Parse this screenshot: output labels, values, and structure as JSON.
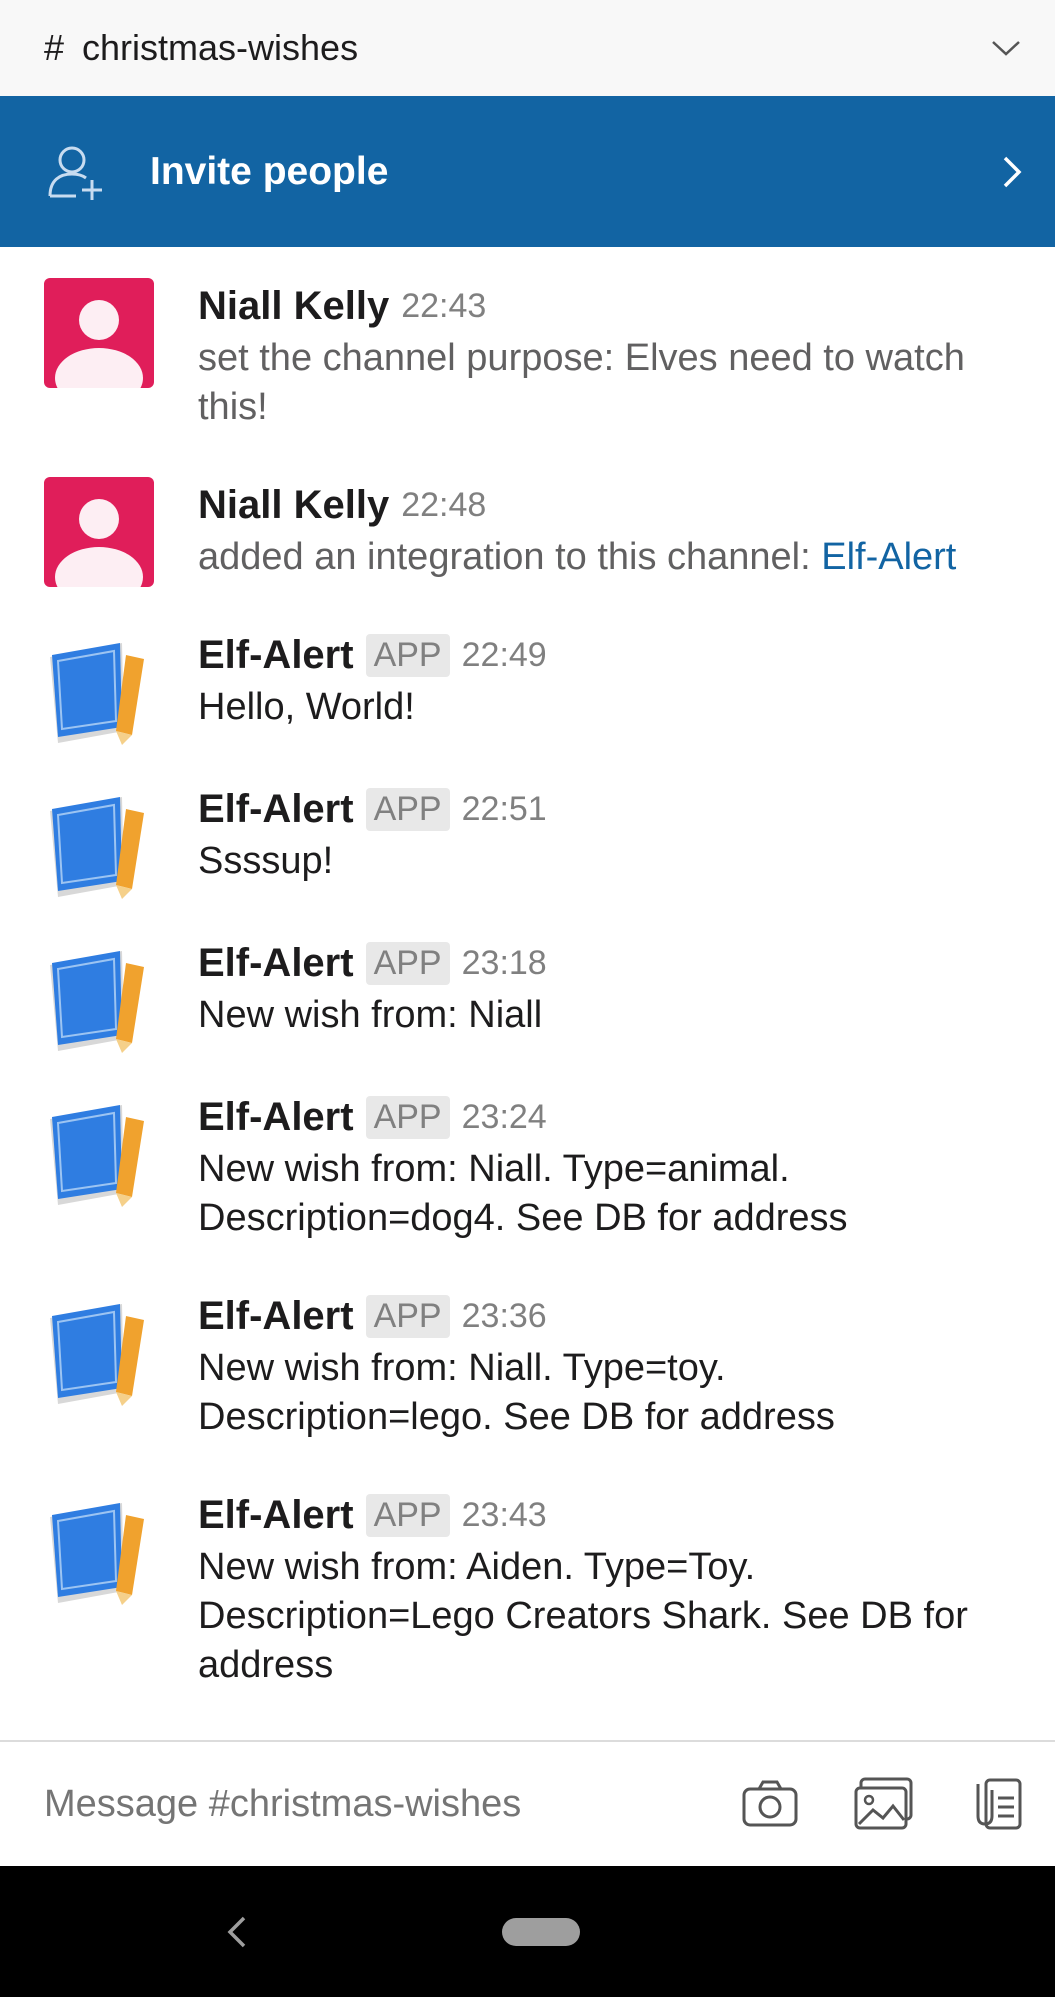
{
  "header": {
    "hash": "#",
    "channel": "christmas-wishes"
  },
  "invite": {
    "label": "Invite people"
  },
  "messages": [
    {
      "author": "Niall Kelly",
      "badge": "",
      "time": "22:43",
      "text": "set the channel purpose: Elves need to watch this!",
      "link": "",
      "type": "user"
    },
    {
      "author": "Niall Kelly",
      "badge": "",
      "time": "22:48",
      "text": "added an integration to this channel: ",
      "link": "Elf-Alert",
      "type": "user"
    },
    {
      "author": "Elf-Alert",
      "badge": "APP",
      "time": "22:49",
      "text": "Hello, World!",
      "link": "",
      "type": "app"
    },
    {
      "author": "Elf-Alert",
      "badge": "APP",
      "time": "22:51",
      "text": "Ssssup!",
      "link": "",
      "type": "app"
    },
    {
      "author": "Elf-Alert",
      "badge": "APP",
      "time": "23:18",
      "text": "New wish from: Niall",
      "link": "",
      "type": "app"
    },
    {
      "author": "Elf-Alert",
      "badge": "APP",
      "time": "23:24",
      "text": "New wish from: Niall. Type=animal. Description=dog4. See DB for address",
      "link": "",
      "type": "app"
    },
    {
      "author": "Elf-Alert",
      "badge": "APP",
      "time": "23:36",
      "text": "New wish from: Niall. Type=toy. Description=lego. See DB for address",
      "link": "",
      "type": "app"
    },
    {
      "author": "Elf-Alert",
      "badge": "APP",
      "time": "23:43",
      "text": "New wish from: Aiden. Type=Toy. Description=Lego Creators Shark. See DB for address",
      "link": "",
      "type": "app"
    }
  ],
  "composer": {
    "placeholder": "Message #christmas-wishes"
  },
  "colors": {
    "brand_blue": "#1264a3",
    "avatar_pink": "#e01e5a"
  }
}
